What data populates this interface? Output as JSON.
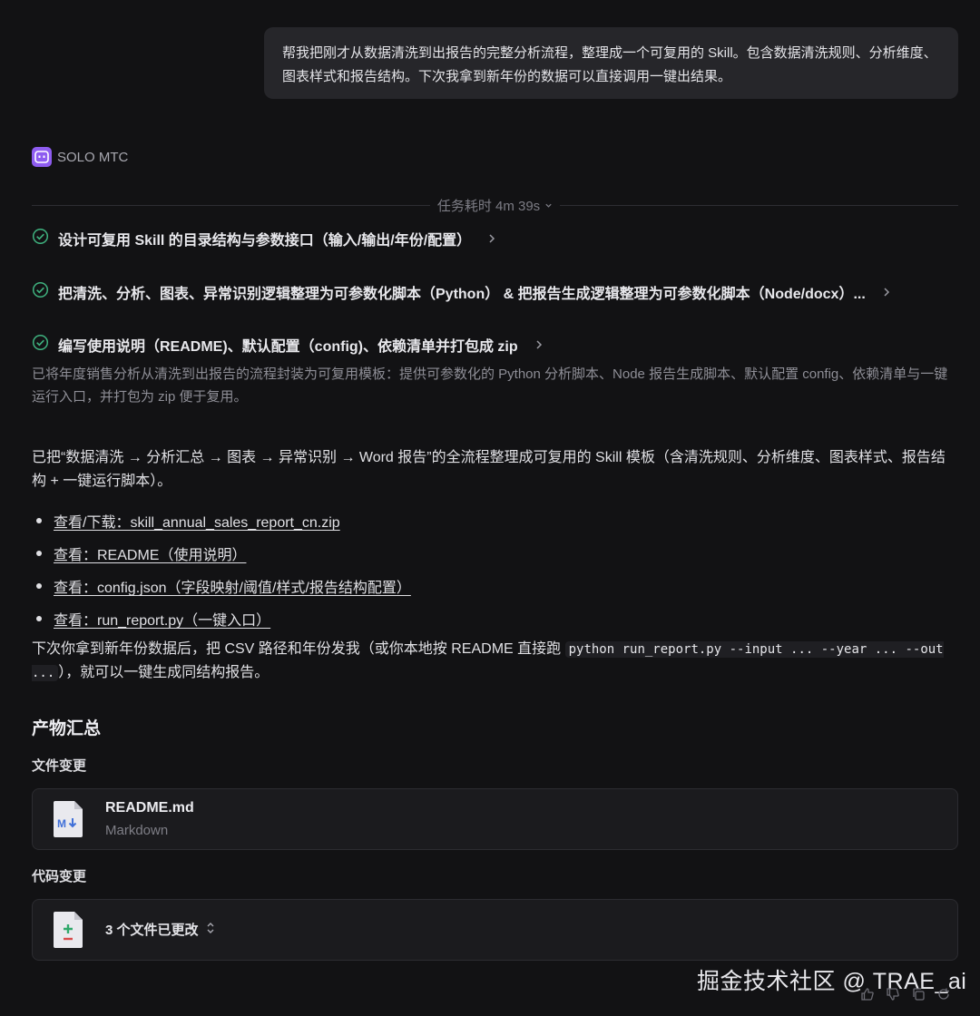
{
  "user_message": "帮我把刚才从数据清洗到出报告的完整分析流程，整理成一个可复用的 Skill。包含数据清洗规则、分析维度、图表样式和报告结构。下次我拿到新年份的数据可以直接调用一键出结果。",
  "agent": {
    "name": "SOLO MTC"
  },
  "task_duration": "任务耗时 4m 39s",
  "tasks": [
    {
      "label": "设计可复用 Skill 的目录结构与参数接口（输入/输出/年份/配置）",
      "status": "done"
    },
    {
      "label": "把清洗、分析、图表、异常识别逻辑整理为可参数化脚本（Python） & 把报告生成逻辑整理为可参数化脚本（Node/docx）...",
      "status": "done"
    },
    {
      "label": "编写使用说明（README)、默认配置（config)、依赖清单并打包成 zip",
      "status": "done"
    }
  ],
  "task_summary": "已将年度销售分析从清洗到出报告的流程封装为可复用模板：提供可参数化的 Python 分析脚本、Node 报告生成脚本、默认配置 config、依赖清单与一键运行入口，并打包为 zip 便于复用。",
  "response": {
    "intro": "已把“数据清洗 → 分析汇总 → 图表 → 异常识别 → Word 报告”的全流程整理成可复用的 Skill 模板（含清洗规则、分析维度、图表样式、报告结构 + 一键运行脚本）。",
    "links": [
      "查看/下载：skill_annual_sales_report_cn.zip",
      "查看：README（使用说明）",
      "查看：config.json（字段映射/阈值/样式/报告结构配置）",
      "查看：run_report.py（一键入口）"
    ],
    "next_prefix": "下次你拿到新年份数据后，把 CSV 路径和年份发我（或你本地按 README 直接跑 ",
    "next_code": "python run_report.py --input ... --year ... --out ...",
    "next_suffix": "），就可以一键生成同结构报告。"
  },
  "artifacts": {
    "title": "产物汇总",
    "file_changes_label": "文件变更",
    "file": {
      "name": "README.md",
      "type": "Markdown"
    },
    "code_changes_label": "代码变更",
    "code_changes_summary": "3 个文件已更改"
  },
  "watermark": "掘金技术社区 @ TRAE_ai",
  "colors": {
    "accent_green": "#3fb27f",
    "avatar_purple": "#8e5cf0",
    "background": "#121214"
  }
}
